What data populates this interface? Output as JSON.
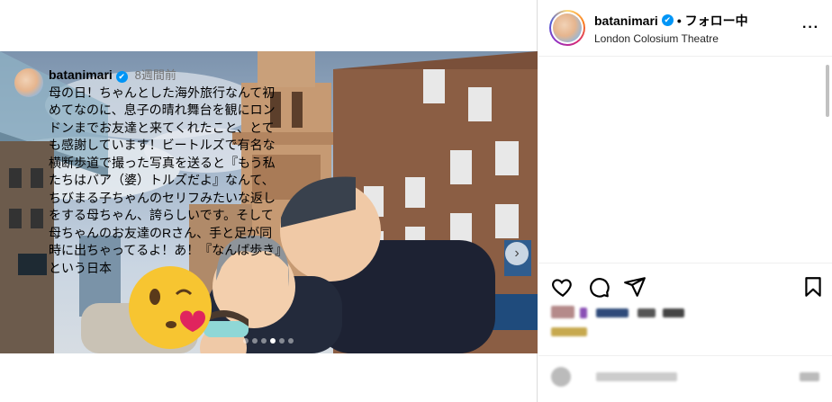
{
  "post": {
    "username": "batanimari",
    "verified_mark": "✔",
    "follow_status": "• フォロー中",
    "location": "London Colosium Theatre",
    "more_icon": "more-icon",
    "caption_username": "batanimari",
    "caption_time": "8週間前",
    "caption_text": "母の日！ちゃんとした海外旅行なんて初めてなのに、息子の晴れ舞台を観にロンドンまでお友達と来てくれたこと、とても感謝しています！ビートルズで有名な横断歩道で撮った写真を送ると『もう私たちはバア（婆）トルズだよ』なんて、ちびまる子ちゃんのセリフみたいな返しをする母ちゃん、誇らしいです。そして母ちゃんのお友達のRさん、手と足が同時に出ちゃってるよ！あ！『なんば歩き』という日本"
  },
  "media": {
    "next_arrow": "›",
    "slide_count": 6,
    "active_slide": 4
  },
  "actions": {
    "like_icon": "heart-icon",
    "comment_icon": "comment-icon",
    "share_icon": "paper-plane-icon",
    "save_icon": "bookmark-icon"
  },
  "colors": {
    "accent": "#0095f6",
    "border": "#dbdbdb",
    "muted_text": "#737373"
  }
}
